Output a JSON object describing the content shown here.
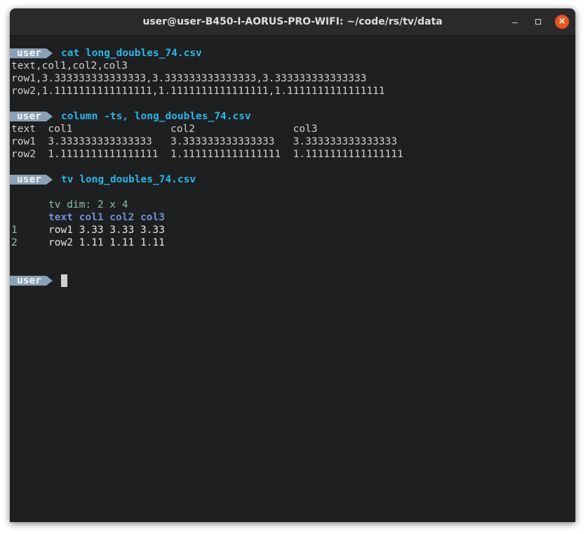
{
  "window": {
    "title": "user@user-B450-I-AORUS-PRO-WIFI: ~/code/rs/tv/data",
    "buttons": {
      "minimize": "minimize",
      "maximize": "maximize",
      "close": "×"
    }
  },
  "colors": {
    "prompt_badge": "#8aa1b5",
    "command": "#29b6e8",
    "close_button": "#e95420",
    "tv_header": "#6f8fd6",
    "tv_meta": "#8fbca6"
  },
  "prompt": {
    "user": "user"
  },
  "blocks": [
    {
      "command": "cat long_doubles_74.csv",
      "output": [
        "text,col1,col2,col3",
        "row1,3.333333333333333,3.333333333333333,3.333333333333333",
        "row2,1.1111111111111111,1.1111111111111111,1.1111111111111111"
      ]
    },
    {
      "command": "column -ts, long_doubles_74.csv",
      "output": [
        "text  col1                col2                col3",
        "row1  3.333333333333333   3.333333333333333   3.333333333333333",
        "row2  1.1111111111111111  1.1111111111111111  1.1111111111111111"
      ]
    },
    {
      "command": "tv long_doubles_74.csv",
      "tv": {
        "dim": "tv dim: 2 x 4",
        "header": "text col1 col2 col3",
        "rows": [
          {
            "index": "1",
            "cells": "row1 3.33 3.33 3.33"
          },
          {
            "index": "2",
            "cells": "row2 1.11 1.11 1.11"
          }
        ]
      }
    }
  ]
}
